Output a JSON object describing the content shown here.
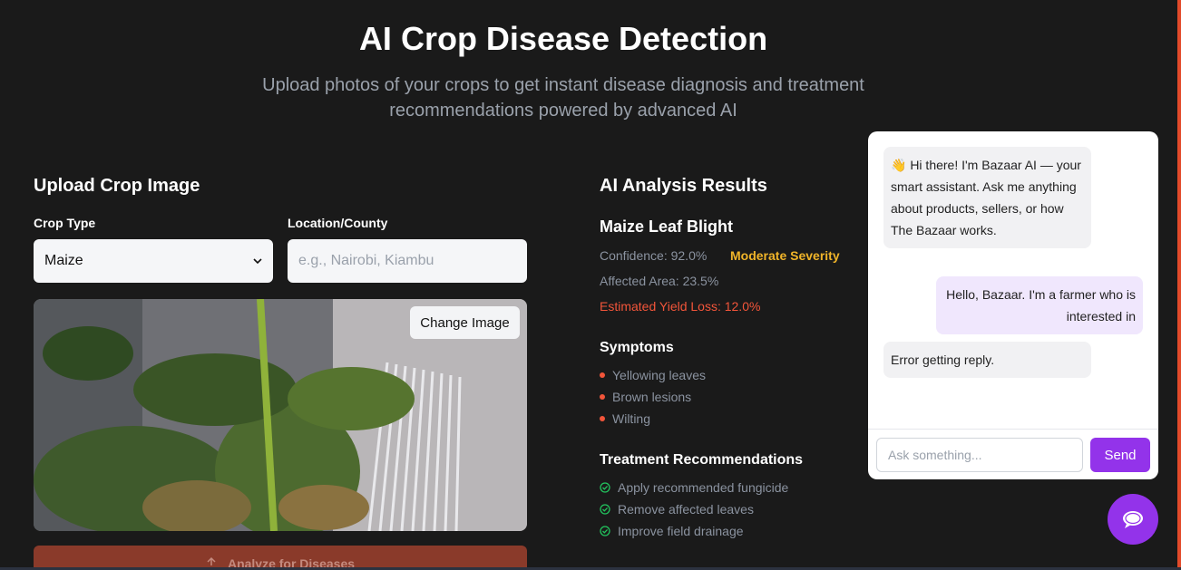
{
  "header": {
    "title": "AI Crop Disease Detection",
    "subtitle": "Upload photos of your crops to get instant disease diagnosis and treatment recommendations powered by advanced AI"
  },
  "upload": {
    "title": "Upload Crop Image",
    "crop_type_label": "Crop Type",
    "crop_type_value": "Maize",
    "location_label": "Location/County",
    "location_placeholder": "e.g., Nairobi, Kiambu",
    "change_image_label": "Change Image",
    "analyze_label": "Analyze for Diseases"
  },
  "results": {
    "title": "AI Analysis Results",
    "disease": "Maize Leaf Blight",
    "confidence": "Confidence: 92.0%",
    "severity": "Moderate Severity",
    "affected_area": "Affected Area: 23.5%",
    "yield_loss": "Estimated Yield Loss: 12.0%",
    "symptoms_title": "Symptoms",
    "symptoms": [
      "Yellowing leaves",
      "Brown lesions",
      "Wilting"
    ],
    "treatment_title": "Treatment Recommendations",
    "treatments": [
      "Apply recommended fungicide",
      "Remove affected leaves",
      "Improve field drainage"
    ]
  },
  "chat": {
    "messages": [
      {
        "role": "bot",
        "text": "👋 Hi there! I'm Bazaar AI — your smart assistant. Ask me anything about products, sellers, or how The Bazaar works."
      },
      {
        "role": "user",
        "text": "Hello, Bazaar. I'm a farmer who is interested in"
      },
      {
        "role": "bot",
        "text": "Error getting reply."
      }
    ],
    "input_placeholder": "Ask something...",
    "send_label": "Send"
  },
  "colors": {
    "background": "#1a1a1a",
    "accent": "#9333ea",
    "severity": "#f0b429",
    "danger": "#f2553a",
    "success": "#22c55e"
  }
}
